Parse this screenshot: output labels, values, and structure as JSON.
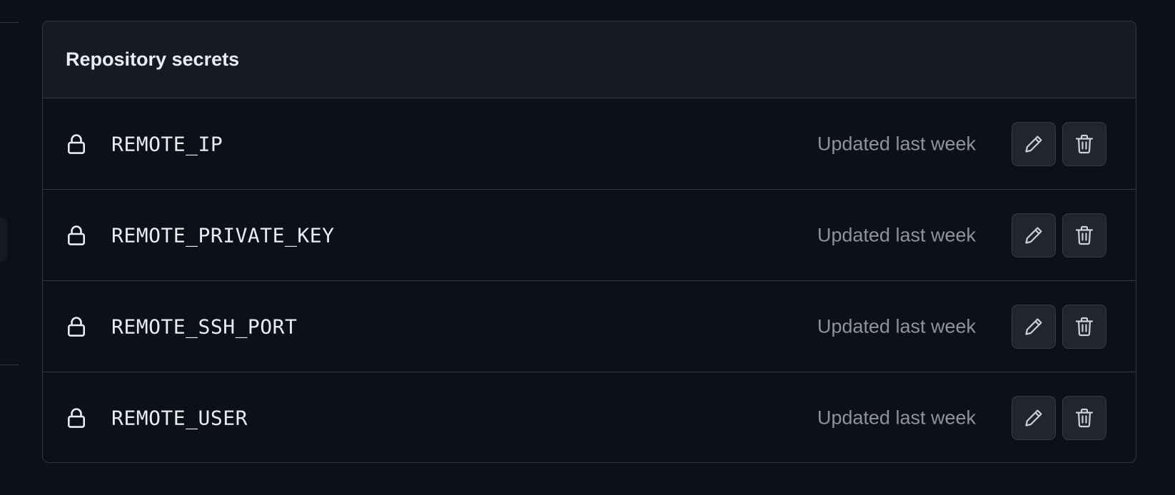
{
  "section": {
    "title": "Repository secrets"
  },
  "secrets": [
    {
      "name": "REMOTE_IP",
      "updated": "Updated last week"
    },
    {
      "name": "REMOTE_PRIVATE_KEY",
      "updated": "Updated last week"
    },
    {
      "name": "REMOTE_SSH_PORT",
      "updated": "Updated last week"
    },
    {
      "name": "REMOTE_USER",
      "updated": "Updated last week"
    }
  ],
  "icons": {
    "row_icon": "lock-icon",
    "edit": "pencil-icon",
    "delete": "trash-icon"
  },
  "colors": {
    "background": "#0d1117",
    "header_background": "#161b22",
    "border": "#30363d",
    "text_primary": "#e6edf3",
    "text_muted": "#8b949e",
    "button_background": "#21262d"
  }
}
